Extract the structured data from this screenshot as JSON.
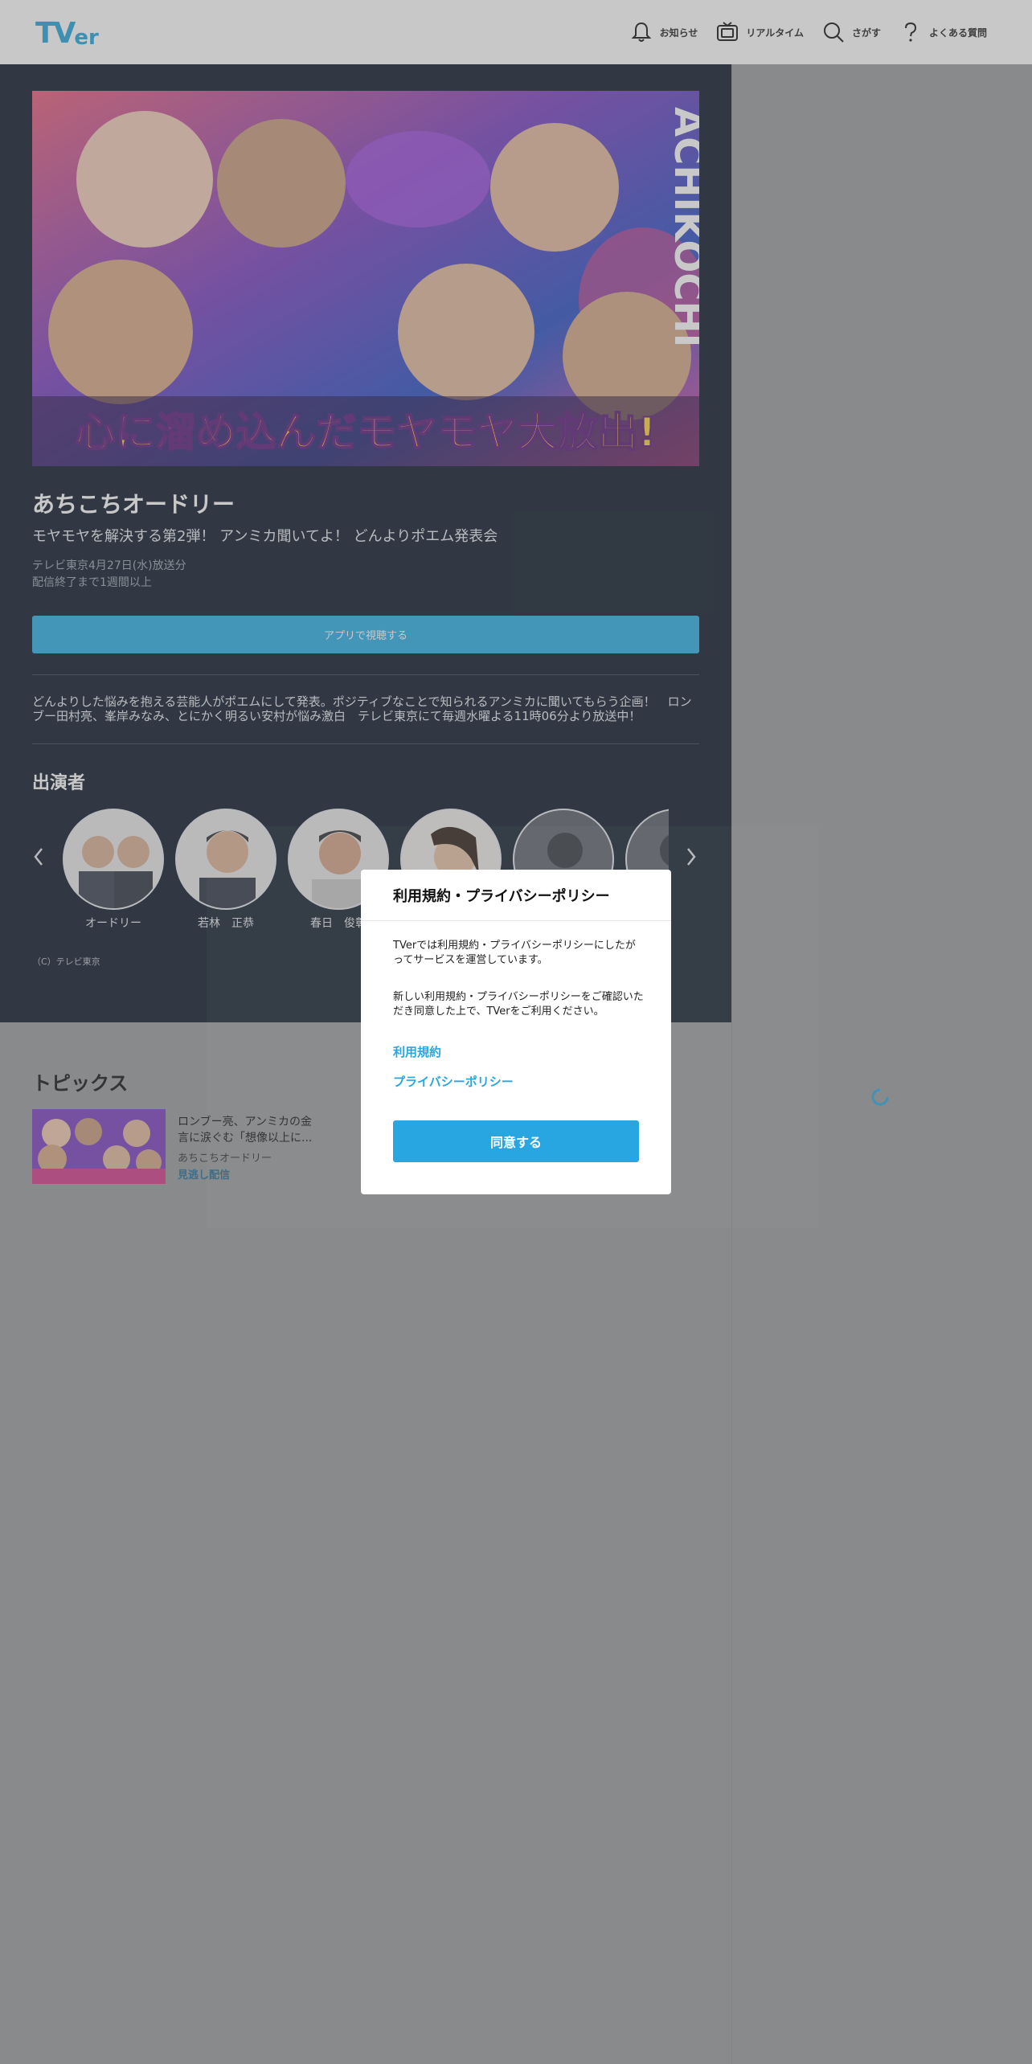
{
  "header": {
    "logo_tv": "TV",
    "logo_er": "er",
    "nav": [
      {
        "label": "お知らせ",
        "icon": "bell-icon"
      },
      {
        "label": "リアルタイム",
        "icon": "tv-icon"
      },
      {
        "label": "さがす",
        "icon": "search-icon"
      },
      {
        "label": "よくある質問",
        "icon": "question-icon"
      }
    ]
  },
  "episode": {
    "banner_text": "心に溜め込んだモヤモヤ大放出!",
    "banner_side_text": "ACHIKOCHI",
    "title": "あちこちオードリー",
    "subtitle": "モヤモヤを解決する第2弾！ アンミカ聞いてよ！ どんよりポエム発表会",
    "broadcast": "テレビ東京4月27日(水)放送分",
    "availability": "配信終了まで1週間以上",
    "watch_button": "アプリで視聴する",
    "description": "どんよりした悩みを抱える芸能人がポエムにして発表。ポジティブなことで知られるアンミカに聞いてもらう企画！　ロンブー田村亮、峯岸みなみ、とにかく明るい安村が悩み激白　テレビ東京にて毎週水曜よる11時06分より放送中！"
  },
  "cast": {
    "heading": "出演者",
    "members": [
      {
        "name": "オードリー"
      },
      {
        "name": "若林　正恭"
      },
      {
        "name": "春日　俊彰"
      },
      {
        "name": ""
      },
      {
        "name": ""
      },
      {
        "name": ""
      }
    ],
    "copyright": "（C）テレビ東京"
  },
  "topics": {
    "heading": "トピックス",
    "items": [
      {
        "title": "ロンブー亮、アンミカの金言に涙ぐむ「想像以上に...",
        "series": "あちこちオードリー",
        "tag": "見逃し配信"
      }
    ]
  },
  "modal": {
    "title": "利用規約・プライバシーポリシー",
    "text1": "TVerでは利用規約・プライバシーポリシーにしたがってサービスを運営しています。",
    "text2": "新しい利用規約・プライバシーポリシーをご確認いただき同意した上で、TVerをご利用ください。",
    "link_terms": "利用規約",
    "link_privacy": "プライバシーポリシー",
    "agree_button": "同意する"
  },
  "colors": {
    "accent": "#27a6e1",
    "main_bg": "#0c1828",
    "page_bg": "#9a9b9d"
  }
}
